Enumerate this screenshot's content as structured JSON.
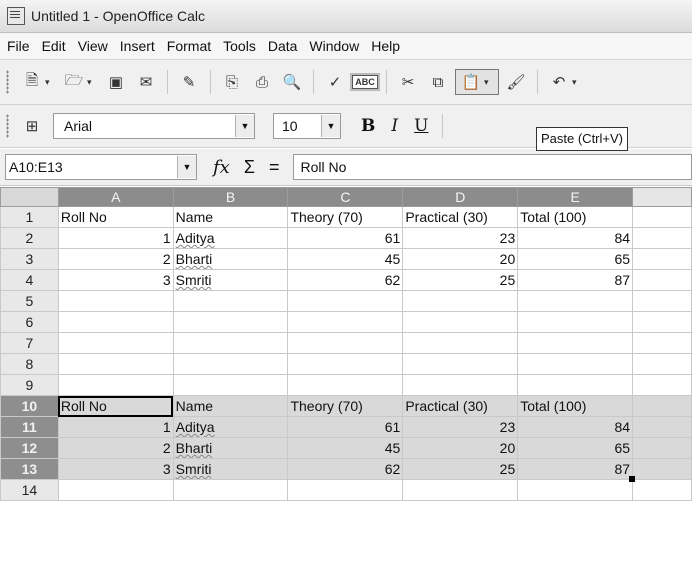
{
  "window": {
    "title": "Untitled 1 - OpenOffice Calc"
  },
  "menu": [
    "File",
    "Edit",
    "View",
    "Insert",
    "Format",
    "Tools",
    "Data",
    "Window",
    "Help"
  ],
  "toolbar": {
    "font_name": "Arial",
    "font_size": "10",
    "bold_label": "B",
    "italic_label": "I",
    "underline_label": "U",
    "spell_label": "ABC",
    "tooltip": "Paste (Ctrl+V)"
  },
  "formula_bar": {
    "name_box": "A10:E13",
    "fx": "fx",
    "sigma": "Σ",
    "equals": "=",
    "content": "Roll No"
  },
  "columns": [
    "A",
    "B",
    "C",
    "D",
    "E",
    ""
  ],
  "rows": [
    {
      "n": "1",
      "cells": [
        "Roll No",
        "Name",
        "Theory (70)",
        "Practical (30)",
        "Total (100)",
        ""
      ]
    },
    {
      "n": "2",
      "cells": [
        "1",
        "Aditya",
        "61",
        "23",
        "84",
        ""
      ]
    },
    {
      "n": "3",
      "cells": [
        "2",
        "Bharti",
        "45",
        "20",
        "65",
        ""
      ]
    },
    {
      "n": "4",
      "cells": [
        "3",
        "Smriti",
        "62",
        "25",
        "87",
        ""
      ]
    },
    {
      "n": "5",
      "cells": [
        "",
        "",
        "",
        "",
        "",
        ""
      ]
    },
    {
      "n": "6",
      "cells": [
        "",
        "",
        "",
        "",
        "",
        ""
      ]
    },
    {
      "n": "7",
      "cells": [
        "",
        "",
        "",
        "",
        "",
        ""
      ]
    },
    {
      "n": "8",
      "cells": [
        "",
        "",
        "",
        "",
        "",
        ""
      ]
    },
    {
      "n": "9",
      "cells": [
        "",
        "",
        "",
        "",
        "",
        ""
      ]
    },
    {
      "n": "10",
      "cells": [
        "Roll No",
        "Name",
        "Theory (70)",
        "Practical (30)",
        "Total (100)",
        ""
      ]
    },
    {
      "n": "11",
      "cells": [
        "1",
        "Aditya",
        "61",
        "23",
        "84",
        ""
      ]
    },
    {
      "n": "12",
      "cells": [
        "2",
        "Bharti",
        "45",
        "20",
        "65",
        ""
      ]
    },
    {
      "n": "13",
      "cells": [
        "3",
        "Smriti",
        "62",
        "25",
        "87",
        ""
      ]
    },
    {
      "n": "14",
      "cells": [
        "",
        "",
        "",
        "",
        "",
        ""
      ]
    }
  ],
  "selected_rows": [
    "10",
    "11",
    "12",
    "13"
  ],
  "active_cell": "A10"
}
